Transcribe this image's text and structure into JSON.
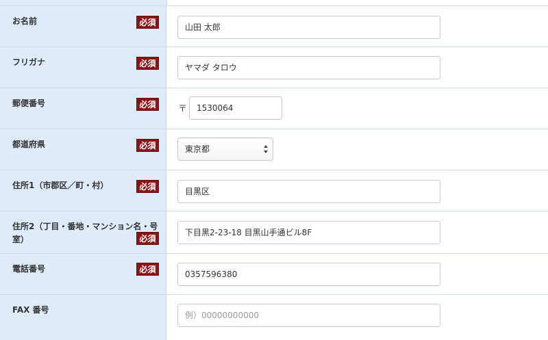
{
  "fields": [
    {
      "label": "お名前",
      "required": true,
      "value": "山田 太郎"
    },
    {
      "label": "フリガナ",
      "required": true,
      "value": "ヤマダ タロウ"
    },
    {
      "label": "郵便番号",
      "required": true,
      "prefix": "〒",
      "value": "1530064"
    },
    {
      "label": "都道府県",
      "required": true,
      "value": "東京都"
    },
    {
      "label": "住所1（市郡区／町・村）",
      "required": true,
      "value": "目黒区"
    },
    {
      "label": "住所2（丁目・番地・マンション名・号室）",
      "required": true,
      "value": "下目黒2-23-18 目黒山手通ビル8F"
    },
    {
      "label": "電話番号",
      "required": true,
      "value": "0357596380"
    },
    {
      "label": "FAX 番号",
      "required": false,
      "value": "",
      "placeholder": "例）00000000000"
    }
  ],
  "required_badge": "必須",
  "icons": {
    "select_arrows": "up-down-arrows-icon"
  }
}
